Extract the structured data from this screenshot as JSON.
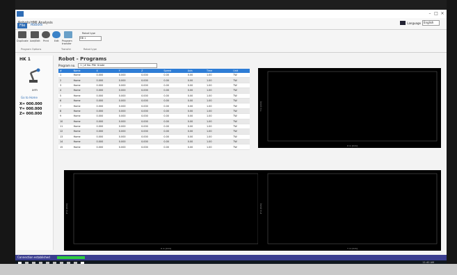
{
  "window": {
    "app_button": "File",
    "tabs": [
      "Robots",
      "HMI Analysis"
    ],
    "ribbon_tabs": [
      "File",
      "Robots"
    ],
    "language_label": "Language",
    "language_value": "English"
  },
  "ribbon": {
    "buttons": [
      "Duplicate",
      "Add/Edit",
      "Print",
      "Edit",
      "Program transfer"
    ],
    "groups": [
      "Program Options",
      "Transfer",
      "Robot type"
    ],
    "robot_type_label": "Robot type",
    "robot_type_value": "HB 1"
  },
  "left_panel": {
    "title": "HK 1",
    "robot_name": "arm",
    "status": "Go to Home",
    "x": "X= 000.000",
    "y": "Y= 000.000",
    "z": "Z= 000.000"
  },
  "main": {
    "title": "Robot - Programs",
    "program_label": "Program no.",
    "program_value": "1 | # No. PW: Grade",
    "table": {
      "headers": [
        "#",
        "Name",
        "X",
        "Y",
        "Z",
        "Speed",
        "Axis",
        "Time",
        "",
        "Unit"
      ],
      "rows": [
        [
          "1",
          "Home",
          "0.000",
          "0.000",
          "0.000",
          "0.00",
          "0.00",
          "1.00",
          "",
          "TW"
        ],
        [
          "2",
          "Home",
          "0.000",
          "0.000",
          "0.000",
          "0.00",
          "0.00",
          "1.00",
          "",
          "TW"
        ],
        [
          "3",
          "Home",
          "0.000",
          "0.000",
          "0.000",
          "0.00",
          "0.00",
          "1.00",
          "",
          "TW"
        ],
        [
          "4",
          "Home",
          "0.000",
          "0.000",
          "0.000",
          "0.00",
          "0.00",
          "1.00",
          "",
          "TW"
        ],
        [
          "5",
          "Home",
          "0.000",
          "0.000",
          "0.000",
          "0.00",
          "0.00",
          "1.00",
          "",
          "TW"
        ],
        [
          "6",
          "Home",
          "0.000",
          "0.000",
          "0.000",
          "0.00",
          "0.00",
          "1.00",
          "",
          "TW"
        ],
        [
          "7",
          "Home",
          "0.000",
          "0.000",
          "0.000",
          "0.00",
          "0.00",
          "1.00",
          "",
          "TW"
        ],
        [
          "8",
          "Home",
          "0.000",
          "0.000",
          "0.000",
          "0.00",
          "0.00",
          "1.00",
          "",
          "TW"
        ],
        [
          "9",
          "Home",
          "0.000",
          "0.000",
          "0.000",
          "0.00",
          "0.00",
          "1.00",
          "",
          "TW"
        ],
        [
          "10",
          "Home",
          "0.000",
          "0.000",
          "0.000",
          "0.00",
          "0.00",
          "1.00",
          "",
          "TW"
        ],
        [
          "11",
          "Home",
          "0.000",
          "0.000",
          "0.000",
          "0.00",
          "0.00",
          "1.00",
          "",
          "TW"
        ],
        [
          "12",
          "Home",
          "0.000",
          "0.000",
          "0.000",
          "0.00",
          "0.00",
          "1.00",
          "",
          "TW"
        ],
        [
          "13",
          "Home",
          "0.000",
          "0.000",
          "0.000",
          "0.00",
          "0.00",
          "1.00",
          "",
          "TW"
        ],
        [
          "14",
          "Home",
          "0.000",
          "0.000",
          "0.000",
          "0.00",
          "0.00",
          "1.00",
          "",
          "TW"
        ],
        [
          "15",
          "Home",
          "0.000",
          "0.000",
          "0.000",
          "0.00",
          "0.00",
          "1.00",
          "",
          "TW"
        ]
      ]
    }
  },
  "charts": [
    {
      "xlabel": "X in [mm]",
      "ylabel": "Y in [mm]"
    },
    {
      "xlabel": "X in [mm]",
      "ylabel": "Z in [mm]"
    },
    {
      "xlabel": "Y in [mm]",
      "ylabel": "Z in [mm]"
    }
  ],
  "status": {
    "text": "Connection established",
    "progress": 1.0
  },
  "taskbar": {
    "time": "11:40 AM"
  },
  "colors": {
    "accent": "#2f6db5",
    "table_header": "#2e7dd6",
    "chart_bg": "#000000",
    "plot_line": "#8fdc8f",
    "status_bar": "#3a3d8f"
  }
}
